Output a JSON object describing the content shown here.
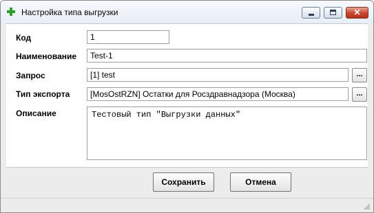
{
  "window": {
    "title": "Настройка типа выгрузки",
    "colors": {
      "titlebar": "#e8eef6",
      "close_button": "#c9452f",
      "app_icon": "#2ca02c"
    }
  },
  "form": {
    "code": {
      "label": "Код",
      "value": "1"
    },
    "name": {
      "label": "Наименование",
      "value": "Test-1"
    },
    "query": {
      "label": "Запрос",
      "value": "[1]  test",
      "browse_label": "..."
    },
    "export_type": {
      "label": "Тип экспорта",
      "value": "[MosOstRZN]  Остатки для Росздравнадзора (Москва)",
      "browse_label": "..."
    },
    "description": {
      "label": "Описание",
      "value": "Тестовый тип \"Выгрузки данных\""
    }
  },
  "buttons": {
    "save": "Сохранить",
    "cancel": "Отмена"
  }
}
